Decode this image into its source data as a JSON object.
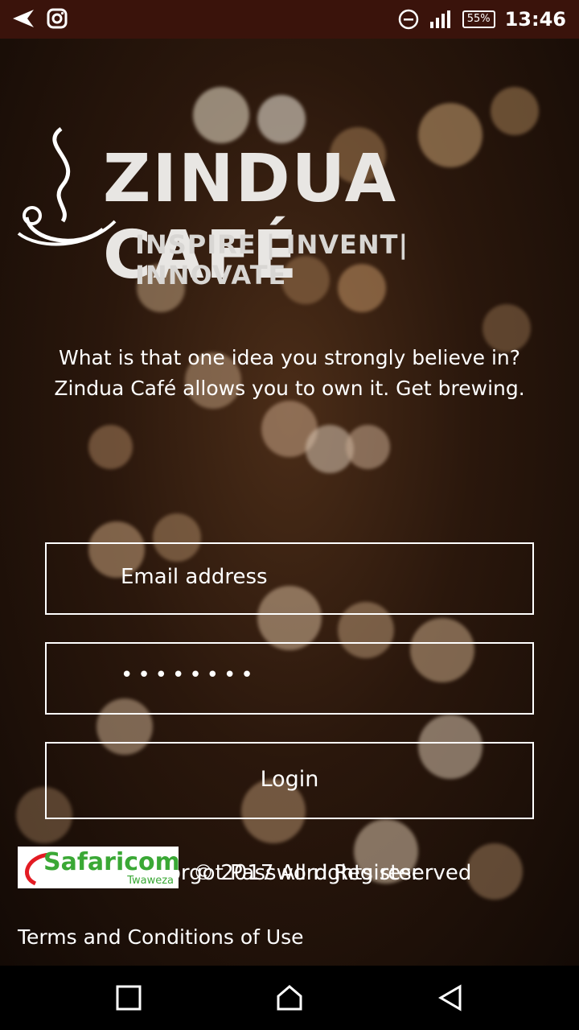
{
  "status_bar": {
    "time": "13:46",
    "battery": "55%"
  },
  "logo": {
    "title": "ZINDUA CAFÉ",
    "tagline": "INSPIRE | INVENT| INNOVATE"
  },
  "intro": {
    "line1": "What is that one idea you strongly believe in?",
    "line2": "Zindua Café allows you to own it. Get brewing."
  },
  "form": {
    "email_placeholder": "Email address",
    "password_value": "••••••••",
    "login_label": "Login"
  },
  "footer": {
    "sponsor_name": "Safaricom",
    "sponsor_sub": "Twaweza",
    "forgot_password": "Forgot Password",
    "copyright": "© 2017 All rights reserved",
    "register": "Register",
    "terms": "Terms and Conditions of Use"
  },
  "navbar": {
    "icons": [
      "recents-icon",
      "home-icon",
      "back-icon"
    ]
  }
}
